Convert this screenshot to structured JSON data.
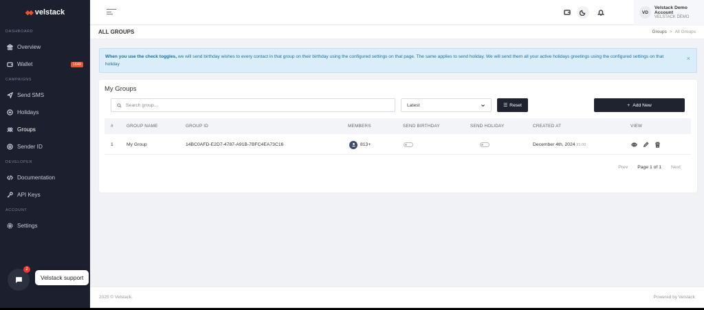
{
  "brand": {
    "name": "velstack"
  },
  "sidebar": {
    "sections": {
      "dashboard": "DASHBOARD",
      "campaigns": "CAMPAIGNS",
      "developer": "DEVELOPER",
      "account": "ACCOUNT"
    },
    "items": [
      {
        "label": "Overview",
        "icon": "bank-icon"
      },
      {
        "label": "Wallet",
        "icon": "wallet-icon",
        "badge": "1649"
      },
      {
        "label": "Send SMS",
        "icon": "send-icon"
      },
      {
        "label": "Holidays",
        "icon": "holiday-icon"
      },
      {
        "label": "Groups",
        "icon": "users-icon"
      },
      {
        "label": "Sender ID",
        "icon": "target-icon"
      },
      {
        "label": "Documentation",
        "icon": "code-icon"
      },
      {
        "label": "API Keys",
        "icon": "key-icon"
      },
      {
        "label": "Settings",
        "icon": "gear-icon"
      }
    ]
  },
  "topbar": {
    "account_initials": "VD",
    "account_name": "Velstack Demo Account",
    "account_sub": "VELSTACK DEMO"
  },
  "page": {
    "title": "ALL GROUPS",
    "breadcrumb_parent": "Groups",
    "breadcrumb_separator": ">",
    "breadcrumb_current": "All Groups"
  },
  "alert": {
    "bold": "When you use the check toggles,",
    "text": " we will send birthday wishes to every contact in that group on their birthday using the configured settings on that page. The same applies to send holiday. We will send them all your active holidays greetings using the configured settings on that holiday",
    "close": "×"
  },
  "card": {
    "title": "My Groups",
    "search_placeholder": "Search group...",
    "sort_value": "Latest",
    "reset_label": "Reset",
    "add_label": "Add New"
  },
  "table": {
    "headers": [
      "#",
      "GROUP NAME",
      "GROUP ID",
      "MEMBERS",
      "SEND BIRTHDAY",
      "SEND HOLIDAY",
      "CREATED AT",
      "VIEW"
    ],
    "rows": [
      {
        "index": "1",
        "name": "My Group",
        "id": "14BC0AFD-E2D7-4787-A91B-7BFC4EA73C16",
        "members": "813+",
        "send_birthday": false,
        "send_holiday": false,
        "created_date": "December 4th, 2024",
        "created_time": "21:00"
      }
    ]
  },
  "pagination": {
    "prev": "Prev",
    "page": "Page 1 of 1",
    "next": "Next"
  },
  "footer": {
    "left": "2025 © Velstack.",
    "right": "Powered by Velstack"
  },
  "chat": {
    "label": "Velstack support",
    "badge": "2"
  },
  "colors": {
    "sidebar": "#1b1f2e",
    "accent": "#e8542b",
    "button": "#1f232f",
    "alert_bg": "#d9eef8"
  }
}
